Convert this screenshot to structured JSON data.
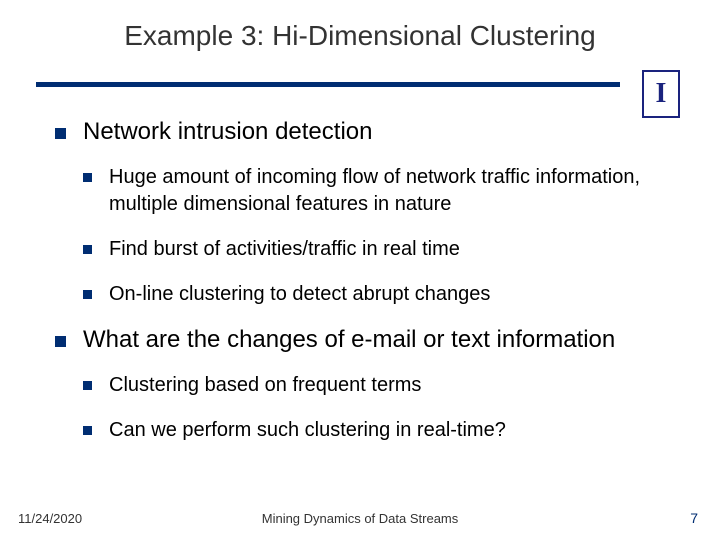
{
  "title": "Example 3: Hi-Dimensional Clustering",
  "logo_letter": "I",
  "bullets": [
    {
      "text": "Network intrusion detection",
      "sub": [
        "Huge amount of incoming flow of network traffic information, multiple dimensional features in nature",
        "Find burst of activities/traffic in real time",
        "On-line clustering to detect abrupt changes"
      ]
    },
    {
      "text": "What are the changes of e-mail or text information",
      "sub": [
        "Clustering based on frequent terms",
        "Can we perform such clustering in real-time?"
      ]
    }
  ],
  "footer": {
    "date": "11/24/2020",
    "center": "Mining Dynamics of Data Streams",
    "page": "7"
  }
}
